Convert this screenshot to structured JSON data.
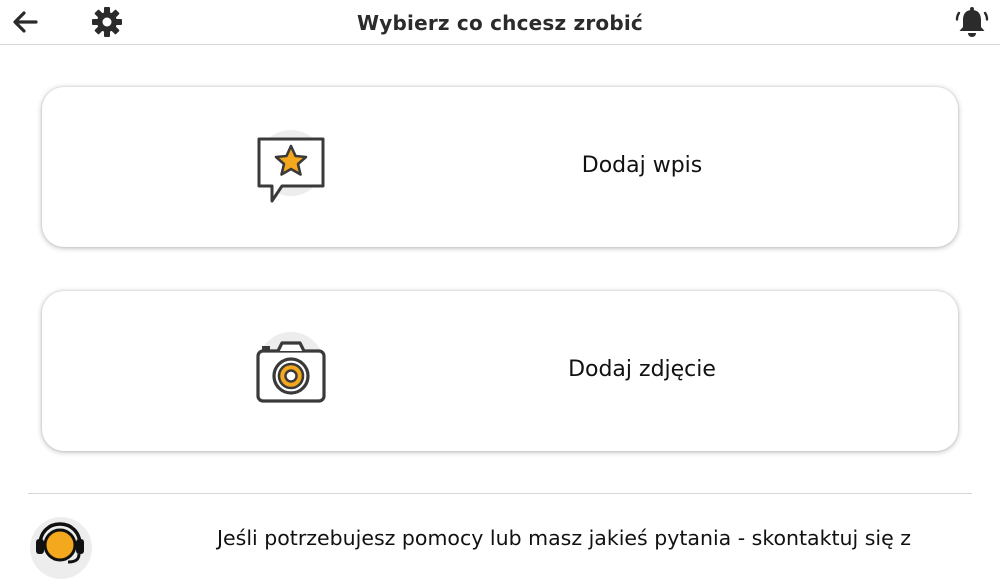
{
  "header": {
    "title": "Wybierz co chcesz zrobić",
    "back_icon": "arrow-left-icon",
    "settings_icon": "gear-icon",
    "notifications_icon": "bell-icon"
  },
  "actions": [
    {
      "label": "Dodaj wpis",
      "icon": "star-speech-bubble-icon"
    },
    {
      "label": "Dodaj zdjęcie",
      "icon": "camera-icon"
    }
  ],
  "help": {
    "text": "Jeśli potrzebujesz pomocy lub masz jakieś pytania - skontaktuj się z",
    "icon": "headset-support-icon"
  },
  "colors": {
    "accent": "#f4a81d",
    "icon_dark": "#3a3a3a",
    "icon_bg": "#e9e9e9",
    "divider": "#d6d6d6"
  }
}
